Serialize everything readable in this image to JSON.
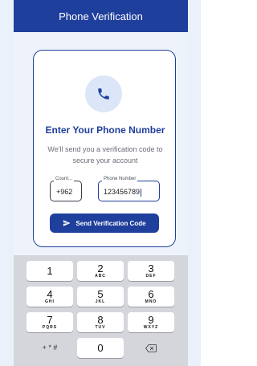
{
  "header": {
    "title": "Phone Verification"
  },
  "card": {
    "title": "Enter Your Phone Number",
    "subtitle": "We'll send you a verification code to secure your account",
    "country": {
      "label": "Count...",
      "value": "+962"
    },
    "phone": {
      "label": "Phone Number",
      "value": "123456789"
    },
    "send_label": "Send Verification Code"
  },
  "keypad": {
    "keys": [
      {
        "num": "1",
        "letters": ""
      },
      {
        "num": "2",
        "letters": "ABC"
      },
      {
        "num": "3",
        "letters": "DEF"
      },
      {
        "num": "4",
        "letters": "GHI"
      },
      {
        "num": "5",
        "letters": "JKL"
      },
      {
        "num": "6",
        "letters": "MNO"
      },
      {
        "num": "7",
        "letters": "PQRS"
      },
      {
        "num": "8",
        "letters": "TUV"
      },
      {
        "num": "9",
        "letters": "WXYZ"
      },
      {
        "num": "+ * #",
        "letters": ""
      },
      {
        "num": "0",
        "letters": ""
      },
      {
        "num": "",
        "letters": ""
      }
    ]
  },
  "colors": {
    "primary": "#1f3f9c",
    "icon_bg": "#dbe6f8",
    "keypad_bg": "#d4d6db"
  },
  "icons": {
    "phone": "phone-icon",
    "send": "send-icon",
    "backspace": "backspace-icon"
  }
}
